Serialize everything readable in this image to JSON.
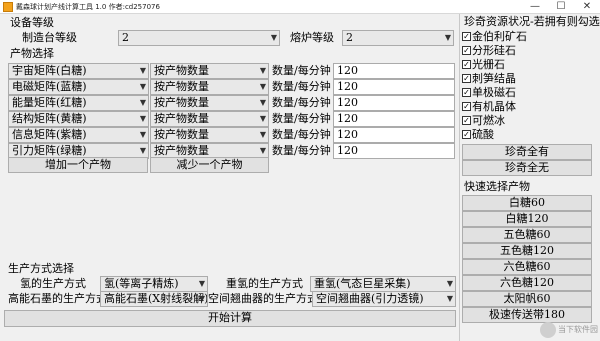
{
  "window": {
    "title": "戴森球计划产线计算工具 1.0 作者:cd257076",
    "minimize": "—",
    "maximize": "☐",
    "close": "✕"
  },
  "equipment": {
    "section_title": "设备等级",
    "assembler_label": "制造台等级",
    "assembler_value": "2",
    "smelter_label": "熔炉等级",
    "smelter_value": "2"
  },
  "products": {
    "section_title": "产物选择",
    "rows": [
      {
        "product": "宇宙矩阵(白糖)",
        "mode": "按产物数量",
        "unit": "数量/每分钟",
        "amount": "120"
      },
      {
        "product": "电磁矩阵(蓝糖)",
        "mode": "按产物数量",
        "unit": "数量/每分钟",
        "amount": "120"
      },
      {
        "product": "能量矩阵(红糖)",
        "mode": "按产物数量",
        "unit": "数量/每分钟",
        "amount": "120"
      },
      {
        "product": "结构矩阵(黄糖)",
        "mode": "按产物数量",
        "unit": "数量/每分钟",
        "amount": "120"
      },
      {
        "product": "信息矩阵(紫糖)",
        "mode": "按产物数量",
        "unit": "数量/每分钟",
        "amount": "120"
      },
      {
        "product": "引力矩阵(绿糖)",
        "mode": "按产物数量",
        "unit": "数量/每分钟",
        "amount": "120"
      }
    ],
    "add_button": "增加一个产物",
    "remove_button": "减少一个产物"
  },
  "production": {
    "section_title": "生产方式选择",
    "hydrogen_label": "氢的生产方式",
    "hydrogen_value": "氢(等离子精炼)",
    "deuterium_label": "重氢的生产方式",
    "deuterium_value": "重氢(气态巨星采集)",
    "graphene_label": "高能石墨的生产方式",
    "graphene_value": "高能石墨(X射线裂解)",
    "warper_label": "空间翘曲器的生产方式",
    "warper_value": "空间翘曲器(引力透镜)",
    "start_button": "开始计算"
  },
  "rare": {
    "section_title": "珍奇资源状况-若拥有则勾选",
    "check_mark": "✓",
    "items": [
      {
        "label": "金伯利矿石",
        "checked": true
      },
      {
        "label": "分形硅石",
        "checked": true
      },
      {
        "label": "光栅石",
        "checked": true
      },
      {
        "label": "刺笋结晶",
        "checked": true
      },
      {
        "label": "单极磁石",
        "checked": true
      },
      {
        "label": "有机晶体",
        "checked": true
      },
      {
        "label": "可燃冰",
        "checked": true
      },
      {
        "label": "硫酸",
        "checked": true
      }
    ],
    "all_button": "珍奇全有",
    "none_button": "珍奇全无"
  },
  "quick": {
    "section_title": "快速选择产物",
    "items": [
      "白糖60",
      "白糖120",
      "五色糖60",
      "五色糖120",
      "六色糖60",
      "六色糖120",
      "太阳帆60",
      "极速传送带180"
    ]
  },
  "watermark": "当下软件园"
}
